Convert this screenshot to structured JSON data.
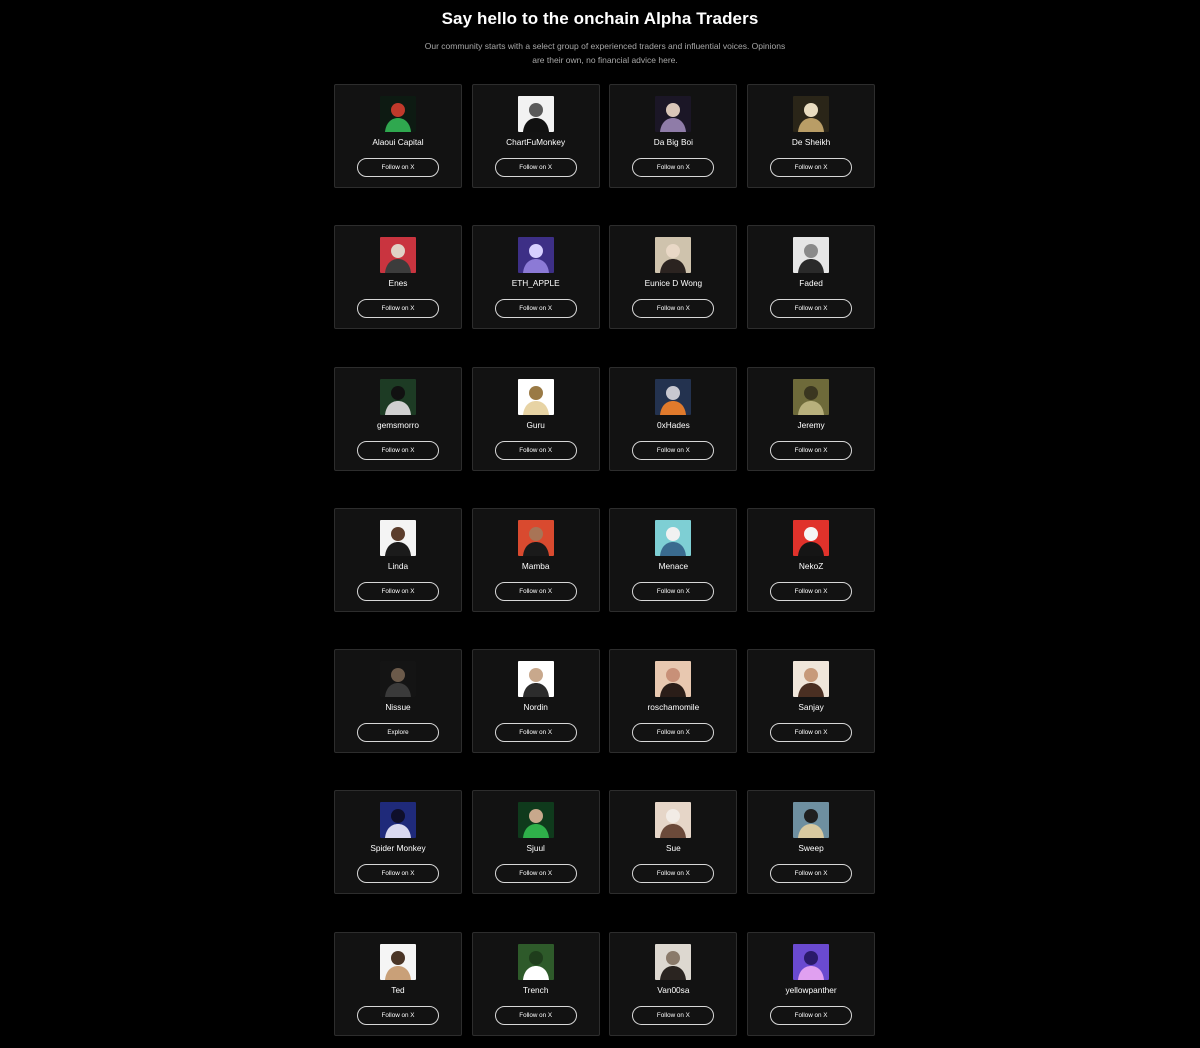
{
  "header": {
    "title": "Say hello to the onchain Alpha Traders",
    "subtitle": "Our community starts with a select group of experienced traders and influential voices. Opinions are their own, no financial advice here."
  },
  "traders": [
    {
      "name": "Alaoui Capital",
      "button": "Follow on X",
      "avatar": "alaoui-capital-avatar",
      "colors": [
        "#0d1a12",
        "#2fa84f",
        "#c0392b"
      ]
    },
    {
      "name": "ChartFuMonkey",
      "button": "Follow on X",
      "avatar": "chartfumonkey-avatar",
      "colors": [
        "#f2f2f2",
        "#111111",
        "#5a5a5a"
      ]
    },
    {
      "name": "Da Big Boi",
      "button": "Follow on X",
      "avatar": "da-big-boi-avatar",
      "colors": [
        "#1b1626",
        "#8f7ca8",
        "#d9c6b8"
      ]
    },
    {
      "name": "De Sheikh",
      "button": "Follow on X",
      "avatar": "de-sheikh-avatar",
      "colors": [
        "#2a2518",
        "#b99d66",
        "#e8dcc0"
      ]
    },
    {
      "name": "Enes",
      "button": "Follow on X",
      "avatar": "enes-avatar",
      "colors": [
        "#c9343f",
        "#3c3c3c",
        "#e0d2c6"
      ]
    },
    {
      "name": "ETH_APPLE",
      "button": "Follow on X",
      "avatar": "eth-apple-avatar",
      "colors": [
        "#3d2f86",
        "#8c7ad6",
        "#d7d0ff"
      ]
    },
    {
      "name": "Eunice D Wong",
      "button": "Follow on X",
      "avatar": "eunice-d-wong-avatar",
      "colors": [
        "#cfc3ad",
        "#2b2320",
        "#e9d8c6"
      ]
    },
    {
      "name": "Faded",
      "button": "Follow on X",
      "avatar": "faded-avatar",
      "colors": [
        "#e6e6e6",
        "#2a2a2a",
        "#8a8a8a"
      ]
    },
    {
      "name": "gemsmorro",
      "button": "Follow on X",
      "avatar": "gemsmorro-avatar",
      "colors": [
        "#1d3b24",
        "#d0d0d0",
        "#111111"
      ]
    },
    {
      "name": "Guru",
      "button": "Follow on X",
      "avatar": "guru-avatar",
      "colors": [
        "#ffffff",
        "#e7d3a4",
        "#9a7a45"
      ]
    },
    {
      "name": "0xHades",
      "button": "Follow on X",
      "avatar": "0xhades-avatar",
      "colors": [
        "#23324f",
        "#e07a2c",
        "#c8c8d0"
      ]
    },
    {
      "name": "Jeremy",
      "button": "Follow on X",
      "avatar": "jeremy-avatar",
      "colors": [
        "#6e6a3a",
        "#b8b07c",
        "#3a3620"
      ]
    },
    {
      "name": "Linda",
      "button": "Follow on X",
      "avatar": "linda-avatar",
      "colors": [
        "#f4f4f4",
        "#1b1b1b",
        "#5b3d2c"
      ]
    },
    {
      "name": "Mamba",
      "button": "Follow on X",
      "avatar": "mamba-avatar",
      "colors": [
        "#d94a2f",
        "#1a1a1a",
        "#a87456"
      ]
    },
    {
      "name": "Menace",
      "button": "Follow on X",
      "avatar": "menace-avatar",
      "colors": [
        "#7ecfd4",
        "#3a6b8f",
        "#f1f1f1"
      ]
    },
    {
      "name": "NekoZ",
      "button": "Follow on X",
      "avatar": "nekoz-avatar",
      "colors": [
        "#e0322b",
        "#151515",
        "#f5f5f5"
      ]
    },
    {
      "name": "Nissue",
      "button": "Explore",
      "avatar": "nissue-avatar",
      "colors": [
        "#141414",
        "#3a3a3a",
        "#6b5a4a"
      ]
    },
    {
      "name": "Nordin",
      "button": "Follow on X",
      "avatar": "nordin-avatar",
      "colors": [
        "#ffffff",
        "#2c2c2c",
        "#c8a88c"
      ]
    },
    {
      "name": "roschamomile",
      "button": "Follow on X",
      "avatar": "roschamomile-avatar",
      "colors": [
        "#e8c8b0",
        "#2a1d18",
        "#c89078"
      ]
    },
    {
      "name": "Sanjay",
      "button": "Follow on X",
      "avatar": "sanjay-avatar",
      "colors": [
        "#f0e6da",
        "#4a2f22",
        "#c79a7a"
      ]
    },
    {
      "name": "Spider Monkey",
      "button": "Follow on X",
      "avatar": "spider-monkey-avatar",
      "colors": [
        "#1f2a7a",
        "#d9d9f0",
        "#0f0f2a"
      ]
    },
    {
      "name": "Sjuul",
      "button": "Follow on X",
      "avatar": "sjuul-avatar",
      "colors": [
        "#0f3a1c",
        "#2fb04a",
        "#c8a88c"
      ]
    },
    {
      "name": "Sue",
      "button": "Follow on X",
      "avatar": "sue-avatar",
      "colors": [
        "#e6d6c8",
        "#6b4a3a",
        "#f2ece6"
      ]
    },
    {
      "name": "Sweep",
      "button": "Follow on X",
      "avatar": "sweep-avatar",
      "colors": [
        "#6e8fa0",
        "#d8c9a0",
        "#1f1f1f"
      ]
    },
    {
      "name": "Ted",
      "button": "Follow on X",
      "avatar": "ted-avatar",
      "colors": [
        "#f5f5f5",
        "#c9a078",
        "#4a3526"
      ]
    },
    {
      "name": "Trench",
      "button": "Follow on X",
      "avatar": "trench-avatar",
      "colors": [
        "#2e5a2a",
        "#ffffff",
        "#1f3d1c"
      ]
    },
    {
      "name": "Van00sa",
      "button": "Follow on X",
      "avatar": "van00sa-avatar",
      "colors": [
        "#ddd8d0",
        "#2a2420",
        "#8a7a6a"
      ]
    },
    {
      "name": "yellowpanther",
      "button": "Follow on X",
      "avatar": "yellowpanther-avatar",
      "colors": [
        "#6a4ad0",
        "#e0a0f0",
        "#2a1a6a"
      ]
    }
  ]
}
